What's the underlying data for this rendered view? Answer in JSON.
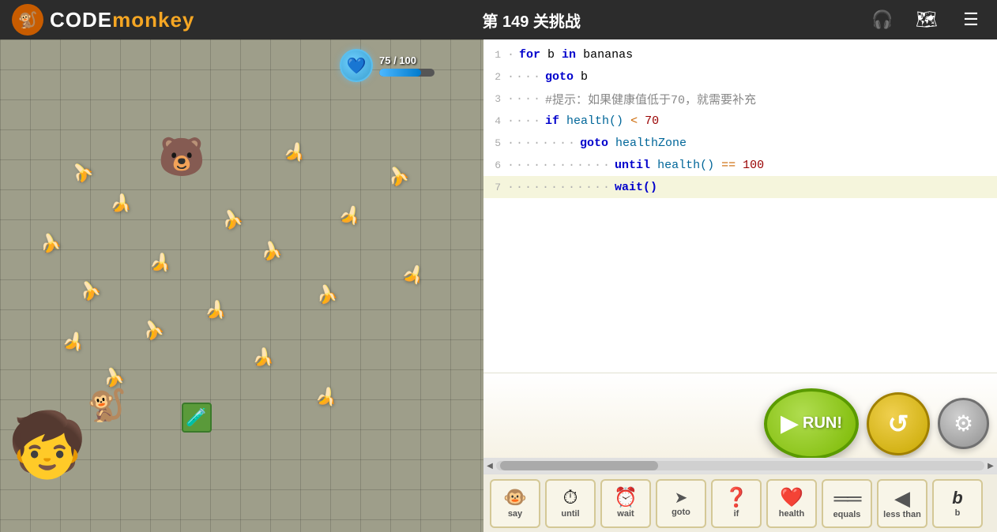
{
  "header": {
    "title": "第 149 关挑战",
    "logo_text_code": "CODE",
    "logo_text_monkey": "monkey",
    "icon_headphones": "🎧",
    "icon_map": "🗺",
    "icon_menu": "☰"
  },
  "health": {
    "current": 75,
    "max": 100,
    "display": "75 / 100",
    "bar_pct": 75
  },
  "code": {
    "lines": [
      {
        "num": "1",
        "dots": "·",
        "text": "for b in bananas"
      },
      {
        "num": "2",
        "dots": "····",
        "text": "goto b"
      },
      {
        "num": "3",
        "dots": "····",
        "text": "#提示：如果健康值低于70，就需要补充"
      },
      {
        "num": "4",
        "dots": "····",
        "text": "if health() < 70"
      },
      {
        "num": "5",
        "dots": "········",
        "text": "goto healthZone"
      },
      {
        "num": "6",
        "dots": "············",
        "text": "until health() == 100"
      },
      {
        "num": "7",
        "dots": "············",
        "text": "wait()"
      }
    ]
  },
  "toolbar": {
    "buttons": [
      {
        "id": "say",
        "label": "say",
        "icon": "🐵"
      },
      {
        "id": "until",
        "label": "until",
        "icon": "⏱"
      },
      {
        "id": "wait",
        "label": "wait",
        "icon": "⏰"
      },
      {
        "id": "goto",
        "label": "goto",
        "icon": "➤"
      },
      {
        "id": "if",
        "label": "if",
        "icon": "❓"
      },
      {
        "id": "health",
        "label": "health",
        "icon": "❤"
      },
      {
        "id": "equals",
        "label": "equals",
        "icon": "═"
      },
      {
        "id": "less_than",
        "label": "less than",
        "icon": "◀"
      },
      {
        "id": "b",
        "label": "b",
        "icon": ""
      }
    ],
    "run_label": "RUN!",
    "reset_icon": "↺",
    "settings_icon": "⚙"
  }
}
